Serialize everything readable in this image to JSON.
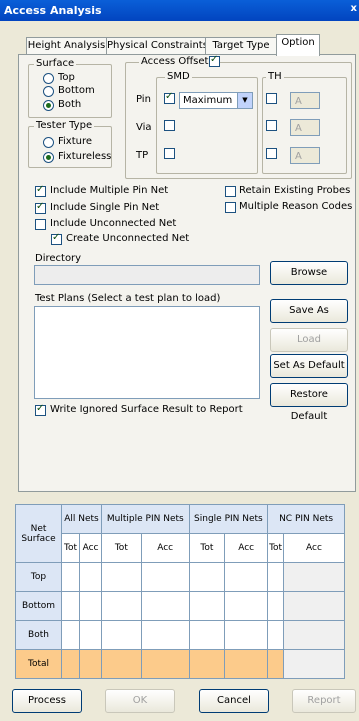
{
  "window": {
    "title": "Access Analysis",
    "close_glyph": "x"
  },
  "tabs": [
    "Height Analysis",
    "Physical Constraints",
    "Target Type",
    "Option"
  ],
  "surface": {
    "label": "Surface",
    "options": [
      "Top",
      "Bottom",
      "Both"
    ],
    "selected": "Both"
  },
  "tester_type": {
    "label": "Tester Type",
    "options": [
      "Fixture",
      "Fixtureless"
    ],
    "selected": "Fixtureless"
  },
  "access_offset": {
    "label": "Access Offset",
    "checked": true,
    "smd_label": "SMD",
    "th_label": "TH",
    "rows": [
      {
        "label": "Pin",
        "smd_checked": true,
        "smd_value": "Maximum",
        "th_checked": false,
        "th_value": "A"
      },
      {
        "label": "Via",
        "smd_checked": false,
        "th_checked": false,
        "th_value": "A"
      },
      {
        "label": "TP",
        "smd_checked": false,
        "th_checked": false,
        "th_value": "A"
      }
    ]
  },
  "options": {
    "include_multiple_pin_net": "Include Multiple Pin Net",
    "include_single_pin_net": "Include Single Pin Net",
    "include_unconnected_net": "Include Unconnected Net",
    "create_unconnected_net": "Create Unconnected Net",
    "retain_existing_probes": "Retain Existing Probes",
    "multiple_reason_codes": "Multiple Reason Codes"
  },
  "directory": {
    "label": "Directory",
    "value": "",
    "browse": "Browse"
  },
  "test_plans": {
    "label": "Test Plans (Select a test plan to load)",
    "save_as": "Save As",
    "load": "Load",
    "set_default": "Set As Default",
    "restore_default": "Restore Default"
  },
  "write_ignored": "Write Ignored Surface Result to Report",
  "grid": {
    "corner": "Net Surface",
    "groups": [
      "All Nets",
      "Multiple PIN Nets",
      "Single PIN Nets",
      "NC PIN Nets"
    ],
    "sub": [
      "Tot",
      "Acc",
      "Tot",
      "Acc",
      "Tot",
      "Acc",
      "Tot",
      "Acc"
    ],
    "rows": [
      "Top",
      "Bottom",
      "Both",
      "Total"
    ]
  },
  "footer": {
    "process": "Process",
    "ok": "OK",
    "cancel": "Cancel",
    "report": "Report"
  },
  "colors": {
    "title_bar": "#0A5FD8",
    "total_row": "#FCCB8B",
    "row_header": "#DCE6F5"
  }
}
